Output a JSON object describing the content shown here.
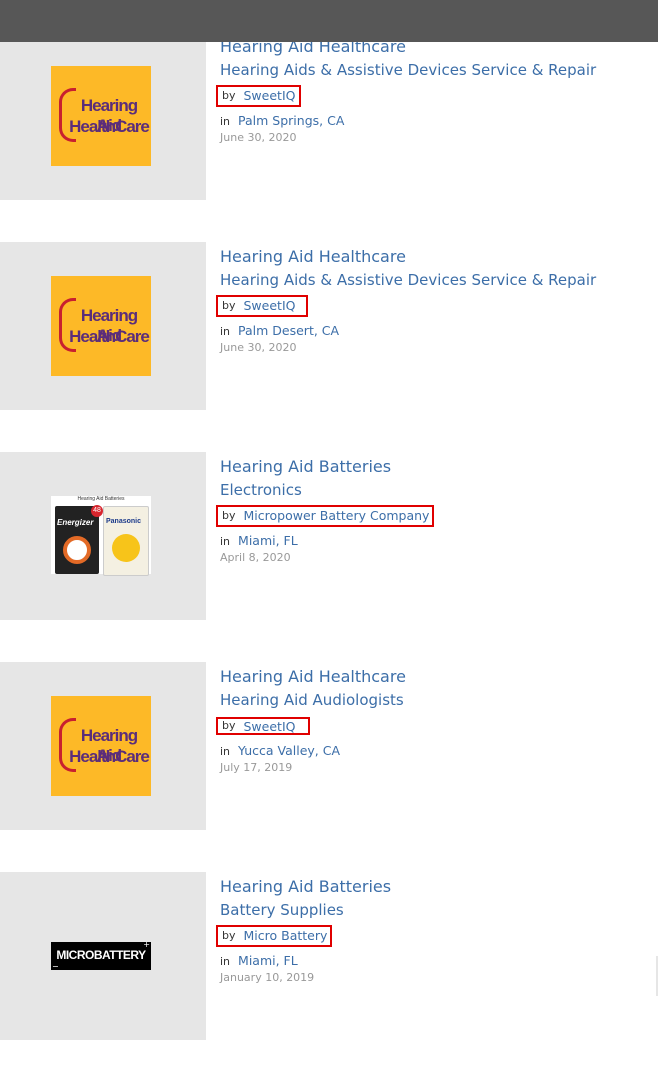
{
  "listings": [
    {
      "title": "Hearing Aid Healthcare",
      "category": "Hearing Aids & Assistive Devices Service & Repair",
      "by_label": "by",
      "author": "SweetIQ",
      "in_label": "in",
      "location": "Palm Springs, CA",
      "date": "June 30, 2020",
      "logo": {
        "line1": "Hearing Aid",
        "line2": "HealthCare"
      }
    },
    {
      "title": "Hearing Aid Healthcare",
      "category": "Hearing Aids & Assistive Devices Service & Repair",
      "by_label": "by",
      "author": "SweetIQ",
      "in_label": "in",
      "location": "Palm Desert, CA",
      "date": "June 30, 2020",
      "logo": {
        "line1": "Hearing Aid",
        "line2": "HealthCare"
      }
    },
    {
      "title": "Hearing Aid Batteries",
      "category": "Electronics",
      "by_label": "by",
      "author": "Micropower Battery Company",
      "in_label": "in",
      "location": "Miami, FL",
      "date": "April 8, 2020",
      "logo": {
        "header": "Hearing Aid Batteries",
        "brand1": "Energizer",
        "brand2": "Panasonic",
        "count": "48"
      }
    },
    {
      "title": "Hearing Aid Healthcare",
      "category": "Hearing Aid Audiologists",
      "by_label": "by",
      "author": "SweetIQ",
      "in_label": "in",
      "location": "Yucca Valley, CA",
      "date": "July 17, 2019",
      "logo": {
        "line1": "Hearing Aid",
        "line2": "HealthCare"
      }
    },
    {
      "title": "Hearing Aid Batteries",
      "category": "Battery Supplies",
      "by_label": "by",
      "author": "Micro Battery",
      "in_label": "in",
      "location": "Miami, FL",
      "date": "January 10, 2019",
      "logo": {
        "text": "MICROBATTERY"
      }
    }
  ],
  "colors": {
    "topbar": "#575757",
    "link": "#3c6ea8",
    "highlight_border": "#e00000",
    "thumb_bg": "#e6e6e6",
    "date": "#999999"
  }
}
